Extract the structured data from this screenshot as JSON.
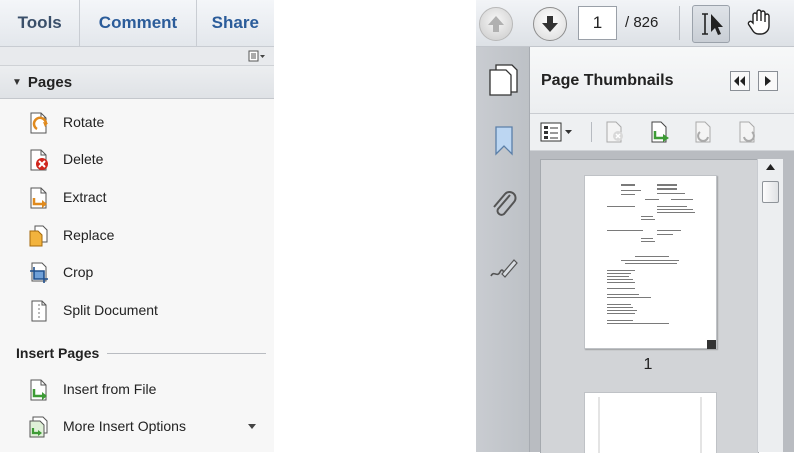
{
  "tabs": [
    {
      "label": "Tools"
    },
    {
      "label": "Comment"
    },
    {
      "label": "Share"
    }
  ],
  "pages_section": {
    "title": "Pages",
    "items": [
      {
        "label": "Rotate",
        "icon": "rotate-page-icon"
      },
      {
        "label": "Delete",
        "icon": "delete-page-icon"
      },
      {
        "label": "Extract",
        "icon": "extract-page-icon"
      },
      {
        "label": "Replace",
        "icon": "replace-page-icon"
      },
      {
        "label": "Crop",
        "icon": "crop-page-icon"
      },
      {
        "label": "Split Document",
        "icon": "split-document-icon"
      }
    ]
  },
  "insert_section": {
    "title": "Insert Pages",
    "items": [
      {
        "label": "Insert from File",
        "icon": "insert-file-icon"
      },
      {
        "label": "More Insert Options",
        "icon": "more-insert-options-icon"
      }
    ]
  },
  "viewer": {
    "current_page": "1",
    "total_pages": "/ 826",
    "thumbnails_title": "Page Thumbnails",
    "thumbnail_page_label": "1"
  },
  "colors": {
    "tab_active": "#3a4f6a",
    "tab_link": "#2b5c9a",
    "rail": "#c2c5ca"
  }
}
